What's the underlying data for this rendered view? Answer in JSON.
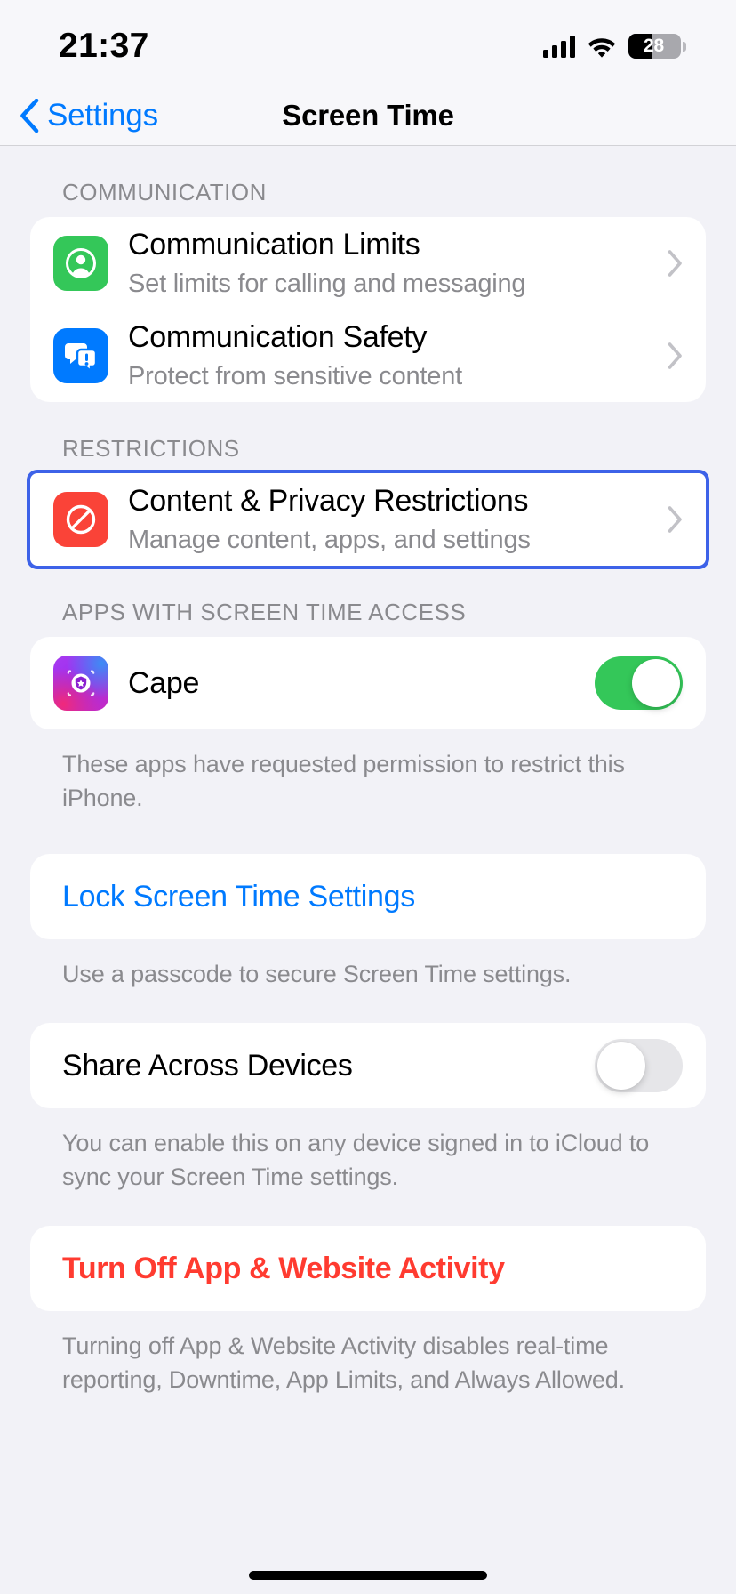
{
  "status_bar": {
    "time": "21:37",
    "battery_percent": "28",
    "cellular_icon": "cellular-signal-icon",
    "wifi_icon": "wifi-icon",
    "battery_icon": "battery-icon"
  },
  "nav": {
    "back_label": "Settings",
    "back_icon": "chevron-left-icon",
    "title": "Screen Time"
  },
  "sections": {
    "communication": {
      "header": "COMMUNICATION",
      "rows": [
        {
          "title": "Communication Limits",
          "subtitle": "Set limits for calling and messaging",
          "icon": "person-circle-icon",
          "icon_color": "#34c759",
          "accessory": "chevron-right-icon"
        },
        {
          "title": "Communication Safety",
          "subtitle": "Protect from sensitive content",
          "icon": "message-bubbles-warning-icon",
          "icon_color": "#007aff",
          "accessory": "chevron-right-icon"
        }
      ]
    },
    "restrictions": {
      "header": "RESTRICTIONS",
      "highlighted": true,
      "highlight_color": "#3d62e8",
      "rows": [
        {
          "title": "Content & Privacy Restrictions",
          "subtitle": "Manage content, apps, and settings",
          "icon": "no-entry-icon",
          "icon_color": "#fa4338",
          "accessory": "chevron-right-icon"
        }
      ]
    },
    "apps_access": {
      "header": "APPS WITH SCREEN TIME ACCESS",
      "rows": [
        {
          "title": "Cape",
          "icon": "cape-app-icon",
          "toggle_state": "on",
          "toggle_color": "#34c759"
        }
      ],
      "footnote": "These apps have requested permission to restrict this iPhone."
    },
    "lock_settings": {
      "label": "Lock Screen Time Settings",
      "label_color": "#007aff",
      "footnote": "Use a passcode to secure Screen Time settings."
    },
    "share_devices": {
      "label": "Share Across Devices",
      "toggle_state": "off",
      "footnote": "You can enable this on any device signed in to iCloud to sync your Screen Time settings."
    },
    "turn_off": {
      "label": "Turn Off App & Website Activity",
      "label_color": "#ff3b30",
      "footnote": "Turning off App & Website Activity disables real-time reporting, Downtime, App Limits, and Always Allowed."
    }
  }
}
